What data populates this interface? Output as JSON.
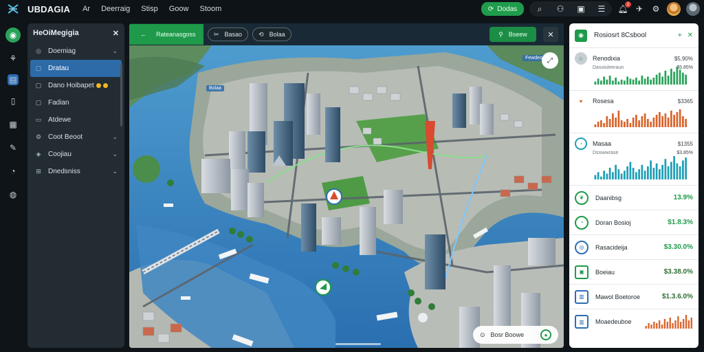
{
  "app": {
    "title": "UBDAGIA",
    "nav": [
      "Ar",
      "Deerraig",
      "Stisp",
      "Goow",
      "Stoom"
    ]
  },
  "topbar": {
    "green_button_label": "Dodas",
    "notification_count": "2"
  },
  "sidebar": {
    "title": "HeOiMegigia",
    "items": [
      {
        "label": "Doemiag",
        "icon": "pin-icon",
        "chevron": true,
        "active": false
      },
      {
        "label": "Dratau",
        "icon": "square-icon",
        "chevron": false,
        "active": true
      },
      {
        "label": "Dano Hoibapet",
        "icon": "square-icon",
        "chevron": false,
        "active": false
      },
      {
        "label": "Fadian",
        "icon": "square-icon",
        "chevron": false,
        "active": false
      },
      {
        "label": "Atdewe",
        "icon": "bookmark-icon",
        "chevron": false,
        "active": false
      },
      {
        "label": "Coot Beoot",
        "icon": "gear-icon",
        "chevron": true,
        "active": false
      },
      {
        "label": "Coojiau",
        "icon": "layers-icon",
        "chevron": true,
        "active": false
      },
      {
        "label": "Dnedsniss",
        "icon": "grid-icon",
        "chevron": true,
        "active": false
      }
    ]
  },
  "map": {
    "tab_label": "Rateanasgoss",
    "pill1_label": "Basao",
    "pill2_label": "Bolaa",
    "green_button_label": "Bseew",
    "tag_label": "Bolaa",
    "tag2_label": "Fewdeo",
    "bottom_chip_label": "Bosr Boowe"
  },
  "right_panel": {
    "title": "Rosiosrt 8Csbool",
    "sections": [
      {
        "title": "Renodixia",
        "value": "$5,90%",
        "sub": "Dasoiuleeraun",
        "sub_value": "$5.85%",
        "color": "#2aa35a",
        "values": [
          3,
          6,
          4,
          8,
          5,
          9,
          4,
          7,
          3,
          5,
          4,
          8,
          6,
          5,
          7,
          4,
          9,
          6,
          8,
          5,
          7,
          10,
          12,
          8,
          14,
          9,
          16,
          13,
          18,
          15,
          12,
          10
        ]
      },
      {
        "title": "Rosesa",
        "value": "$3365",
        "sub": "",
        "sub_value": "",
        "color": "#d9652d",
        "values": [
          2,
          4,
          5,
          3,
          8,
          6,
          10,
          7,
          12,
          5,
          4,
          6,
          3,
          7,
          9,
          5,
          8,
          10,
          6,
          4,
          7,
          9,
          11,
          8,
          10,
          7,
          12,
          9,
          11,
          13,
          8,
          6
        ]
      },
      {
        "title": "Masaa",
        "value": "$1355",
        "sub": "Dssiwwrase",
        "sub_value": "$3.85%",
        "color": "#1f9fb5",
        "values": [
          3,
          5,
          2,
          6,
          4,
          8,
          5,
          10,
          7,
          4,
          6,
          9,
          12,
          8,
          5,
          7,
          10,
          6,
          9,
          13,
          8,
          11,
          7,
          10,
          14,
          9,
          12,
          16,
          11,
          9,
          13,
          15
        ]
      }
    ],
    "rows": [
      {
        "label": "Daanibsg",
        "value": "13.9%",
        "icon": "leaf-icon"
      },
      {
        "label": "Doran Bosioj",
        "value": "$1.8.3%",
        "icon": "clock-icon"
      },
      {
        "label": "Rasacideija",
        "value": "$3.30.0%",
        "icon": "target-icon"
      },
      {
        "label": "Boeiau",
        "value": "$3.38.0%",
        "icon": "image-icon"
      },
      {
        "label": "Mawol Boetoroe",
        "value": "$1.3.6.0%",
        "icon": "building-icon"
      }
    ],
    "last_row": {
      "label": "Moaedeuboe",
      "color": "#d9652d",
      "values": [
        2,
        4,
        3,
        5,
        4,
        6,
        3,
        7,
        5,
        8,
        4,
        6,
        9,
        5,
        7,
        10,
        6,
        8
      ]
    }
  }
}
